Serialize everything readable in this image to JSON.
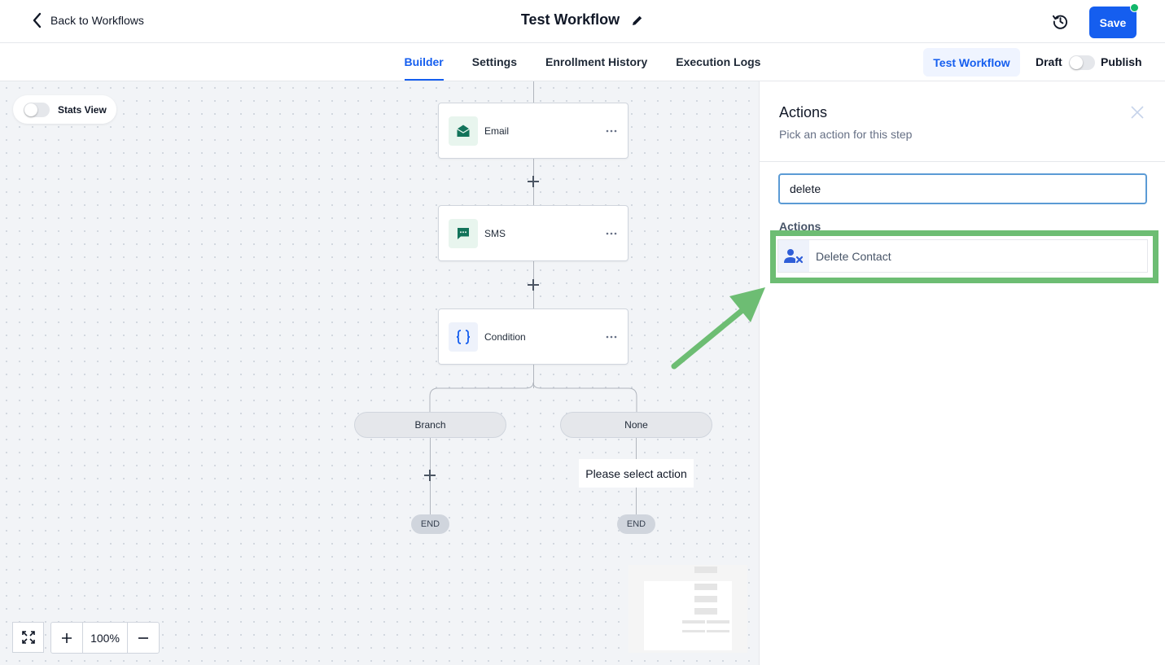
{
  "header": {
    "back_label": "Back to Workflows",
    "title": "Test Workflow",
    "save_label": "Save"
  },
  "tabs": [
    {
      "label": "Builder",
      "active": true
    },
    {
      "label": "Settings"
    },
    {
      "label": "Enrollment History"
    },
    {
      "label": "Execution Logs"
    }
  ],
  "toolbar": {
    "test_label": "Test Workflow",
    "draft_label": "Draft",
    "publish_label": "Publish"
  },
  "canvas": {
    "stats_label": "Stats View",
    "nodes": [
      {
        "label": "Email",
        "icon": "email-icon"
      },
      {
        "label": "SMS",
        "icon": "sms-icon"
      },
      {
        "label": "Condition",
        "icon": "condition-icon"
      }
    ],
    "branches": [
      {
        "label": "Branch"
      },
      {
        "label": "None"
      }
    ],
    "select_action_label": "Please select action",
    "end_label": "END",
    "zoom_value": "100%"
  },
  "panel": {
    "title": "Actions",
    "subtitle": "Pick an action for this step",
    "search_value": "delete",
    "section_label": "Actions",
    "results": [
      {
        "label": "Delete Contact",
        "icon": "delete-contact-icon"
      }
    ]
  },
  "colors": {
    "primary": "#155eef",
    "highlight": "#6dbd73",
    "status_dot": "#12b76a"
  }
}
